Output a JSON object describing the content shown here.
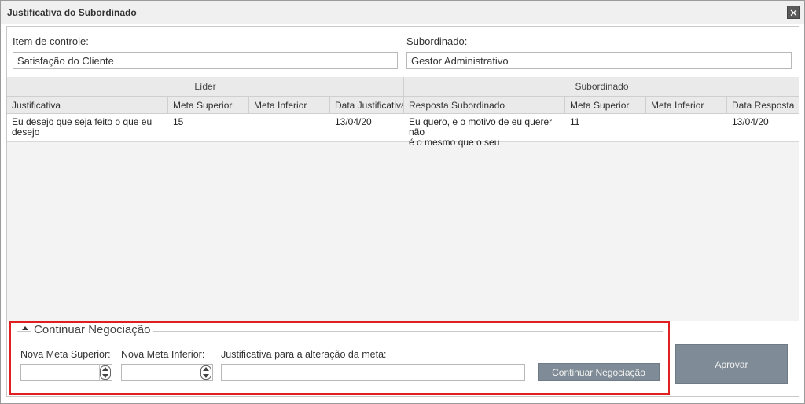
{
  "window": {
    "title": "Justificativa do Subordinado",
    "close_label": "✕"
  },
  "form": {
    "item_label": "Item de controle:",
    "item_value": "Satisfação do Cliente",
    "sub_label": "Subordinado:",
    "sub_value": "Gestor Administrativo"
  },
  "grid": {
    "groups": [
      "Líder",
      "Subordinado"
    ],
    "columns": [
      "Justificativa",
      "Meta Superior",
      "Meta Inferior",
      "Data Justificativa",
      "Resposta Subordinado",
      "Meta Superior",
      "Meta Inferior",
      "Data Resposta"
    ],
    "rows": [
      {
        "justificativa_l1": "Eu desejo que seja feito o que eu",
        "justificativa_l2": "desejo",
        "meta_superior": "15",
        "meta_inferior": "",
        "data_justificativa": "13/04/20",
        "resposta_l1": "Eu quero, e o motivo de eu querer não",
        "resposta_l2": "é o mesmo que o seu",
        "sub_meta_superior": "11",
        "sub_meta_inferior": "",
        "data_resposta": "13/04/20"
      }
    ]
  },
  "negotiation": {
    "header": "Continuar Negociação",
    "nova_meta_superior_label": "Nova Meta Superior:",
    "nova_meta_inferior_label": "Nova Meta Inferior:",
    "justificativa_label": "Justificativa para a alteração da meta:",
    "nova_meta_superior_value": "",
    "nova_meta_inferior_value": "",
    "justificativa_value": "",
    "continue_button": "Continuar Negociação"
  },
  "approve_button": "Aprovar",
  "colors": {
    "highlight": "#e02020",
    "button": "#7f8b96"
  }
}
